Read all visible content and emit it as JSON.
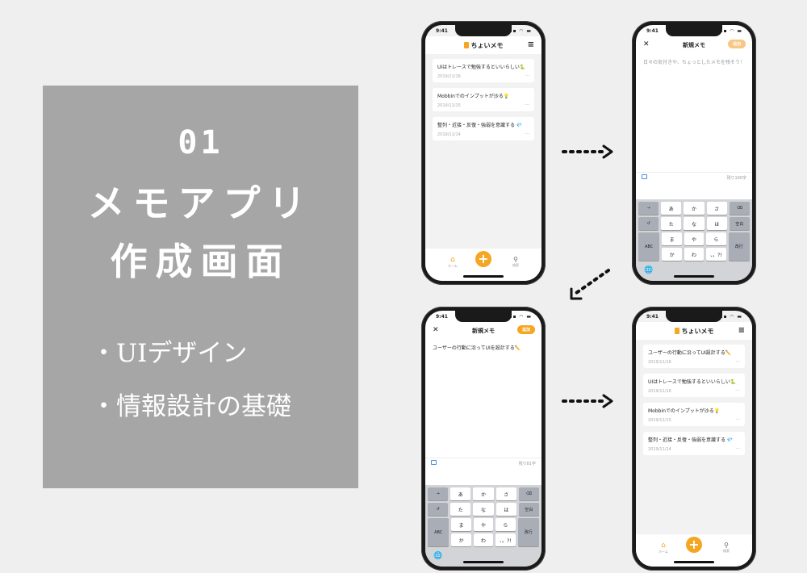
{
  "panel": {
    "number": "01",
    "title_line1": "メモアプリ",
    "title_line2": "作成画面",
    "bullet1": "・UIデザイン",
    "bullet2": "・情報設計の基礎"
  },
  "status": {
    "time": "9:41",
    "icons": "▪▪ ◠ ▬"
  },
  "list1": {
    "app_title": "ちょいメモ",
    "items": [
      {
        "title": "UIはトレースで勉強するといいらしい🐍",
        "date": "2019/11/16"
      },
      {
        "title": "Mobbinでのインプットが沙る💡",
        "date": "2019/11/15"
      },
      {
        "title": "整列・近接・反復・強弱を意識する 💎",
        "date": "2019/11/14"
      }
    ],
    "tab_home": "ホーム",
    "tab_add": "+",
    "tab_search": "検索"
  },
  "edit1": {
    "close": "✕",
    "title": "新規メモ",
    "save": "追加",
    "placeholder": "日々の気付きや、ちょっとしたメモを残そう！",
    "count": "残り100字"
  },
  "edit2": {
    "close": "✕",
    "title": "新規メモ",
    "save": "追加",
    "text": "ユーザーの行動に沿ってUIを設計する✏️",
    "count": "残り81字"
  },
  "list2": {
    "app_title": "ちょいメモ",
    "items": [
      {
        "title": "ユーザーの行動に沿ってUI設計する✏️",
        "date": "2019/11/16"
      },
      {
        "title": "UIはトレースで勉強するといいらしい🐍",
        "date": "2019/11/16"
      },
      {
        "title": "Mobbinでのインプットが沙る💡",
        "date": "2019/11/15"
      },
      {
        "title": "整列・近接・反復・強弱を意識する 💎",
        "date": "2019/11/14"
      }
    ],
    "tab_home": "ホーム",
    "tab_add": "+",
    "tab_search": "検索"
  },
  "keyboard": {
    "row1": [
      "→",
      "あ",
      "か",
      "さ",
      "⌫"
    ],
    "row2": [
      "↺",
      "た",
      "な",
      "は",
      "空白"
    ],
    "row3": [
      "ABC",
      "ま",
      "や",
      "ら",
      "改行"
    ],
    "row4": [
      "わ",
      "゛゜小",
      "!?"
    ],
    "row4_labels": [
      "か",
      "わ",
      "、。?!"
    ],
    "globe": "🌐"
  },
  "colors": {
    "accent": "#f5a623",
    "panel": "#a6a6a6"
  }
}
